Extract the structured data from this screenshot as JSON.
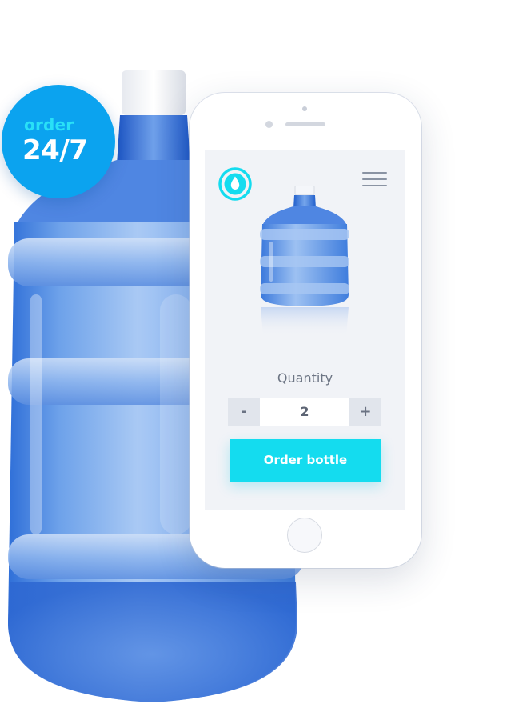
{
  "badge": {
    "line1": "order",
    "line2": "24/7"
  },
  "app": {
    "logo_icon": "water-drop-icon",
    "menu_icon": "hamburger-menu-icon",
    "product_image": "water-bottle",
    "quantity_label": "Quantity",
    "stepper": {
      "minus_label": "-",
      "value": "2",
      "plus_label": "+"
    },
    "order_button_label": "Order bottle"
  },
  "colors": {
    "accent": "#14dcef",
    "badge_blue": "#0ba3ef",
    "badge_text_cyan": "#29e0f7",
    "screen_bg": "#f1f3f7"
  }
}
